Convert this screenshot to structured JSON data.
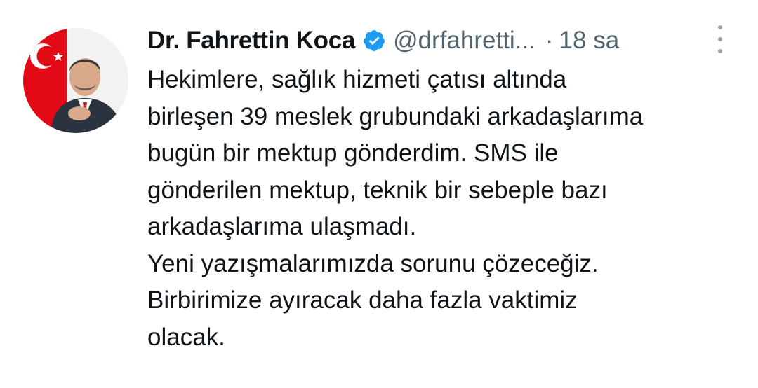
{
  "author": {
    "name": "Dr. Fahrettin Koca",
    "handle": "@drfahretti...",
    "separator": "·",
    "time": "18 sa",
    "verified": true,
    "avatar": "profile-photo-with-turkish-flag"
  },
  "tweet": {
    "lines": [
      "Hekimlere, sağlık hizmeti çatısı altında",
      "birleşen 39 meslek grubundaki arkadaşlarıma",
      "bugün bir mektup gönderdim. SMS ile",
      "gönderilen mektup, teknik bir sebeple bazı",
      "arkadaşlarıma ulaşmadı.",
      "Yeni yazışmalarımızda sorunu çözeceğiz.",
      "Birbirimize ayıracak daha fazla vaktimiz",
      "olacak."
    ]
  },
  "icons": {
    "verified": "verified-badge-icon",
    "more": "more-options-icon"
  },
  "colors": {
    "text": "#0f1419",
    "secondary": "#536471",
    "verified": "#1d9bf0",
    "flag_red": "#e30a17"
  }
}
